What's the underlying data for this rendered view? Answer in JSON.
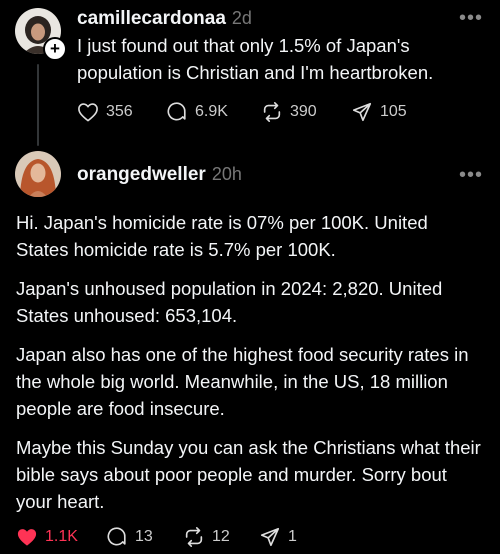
{
  "post": {
    "username": "camillecardonaa",
    "time": "2d",
    "text_line1": "I just found out that only 1.5% of Japan's",
    "text_line2": "population is Christian and I'm heartbroken.",
    "likes": "356",
    "replies": "6.9K",
    "reposts": "390",
    "shares": "105"
  },
  "reply": {
    "username": "orangedweller",
    "time": "20h",
    "paragraphs": [
      "Hi. Japan's homicide rate is 07% per 100K. United States homicide rate is 5.7% per 100K.",
      "Japan's unhoused population in 2024: 2,820. United States unhoused: 653,104.",
      "Japan also has one of the highest food security rates in the whole big world. Meanwhile, in the US, 18 million people are food insecure.",
      "Maybe this Sunday you can ask the Christians what their bible says about poor people and murder. Sorry bout your heart."
    ],
    "likes": "1.1K",
    "replies": "13",
    "reposts": "12",
    "shares": "1"
  },
  "more_label": "•••",
  "plus_label": "+",
  "icons": {
    "like": "heart-icon",
    "reply": "comment-icon",
    "repost": "repost-icon",
    "share": "share-icon",
    "follow": "plus-icon",
    "more": "more-icon"
  },
  "colors": {
    "background": "#000000",
    "text": "#f3f5f7",
    "muted": "#777777",
    "liked": "#fe3355"
  }
}
